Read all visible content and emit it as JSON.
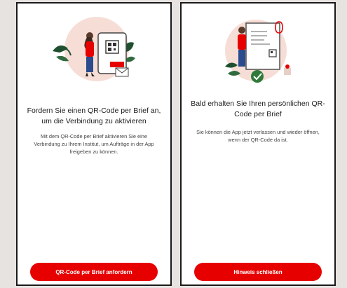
{
  "screen_left": {
    "title": "Fordern Sie einen QR-Code per Brief an, um die Verbindung zu aktivieren",
    "body": "Mit dem QR-Code per Brief aktivieren Sie eine Verbindung zu Ihrem Institut, um Aufträge in der App freigeben zu können.",
    "button_label": "QR-Code per Brief anfordern",
    "illustration_icon": "person-with-qr-phone-illustration"
  },
  "screen_right": {
    "title": "Bald erhalten Sie Ihren persönlichen QR-Code per Brief",
    "body": "Sie können die App jetzt verlassen und wieder öffnen, wenn der QR-Code da ist.",
    "button_label": "Hinweis schließen",
    "illustration_icon": "person-with-letter-checkmark-illustration"
  },
  "colors": {
    "accent": "#e60000",
    "background": "#e6e3e0"
  }
}
